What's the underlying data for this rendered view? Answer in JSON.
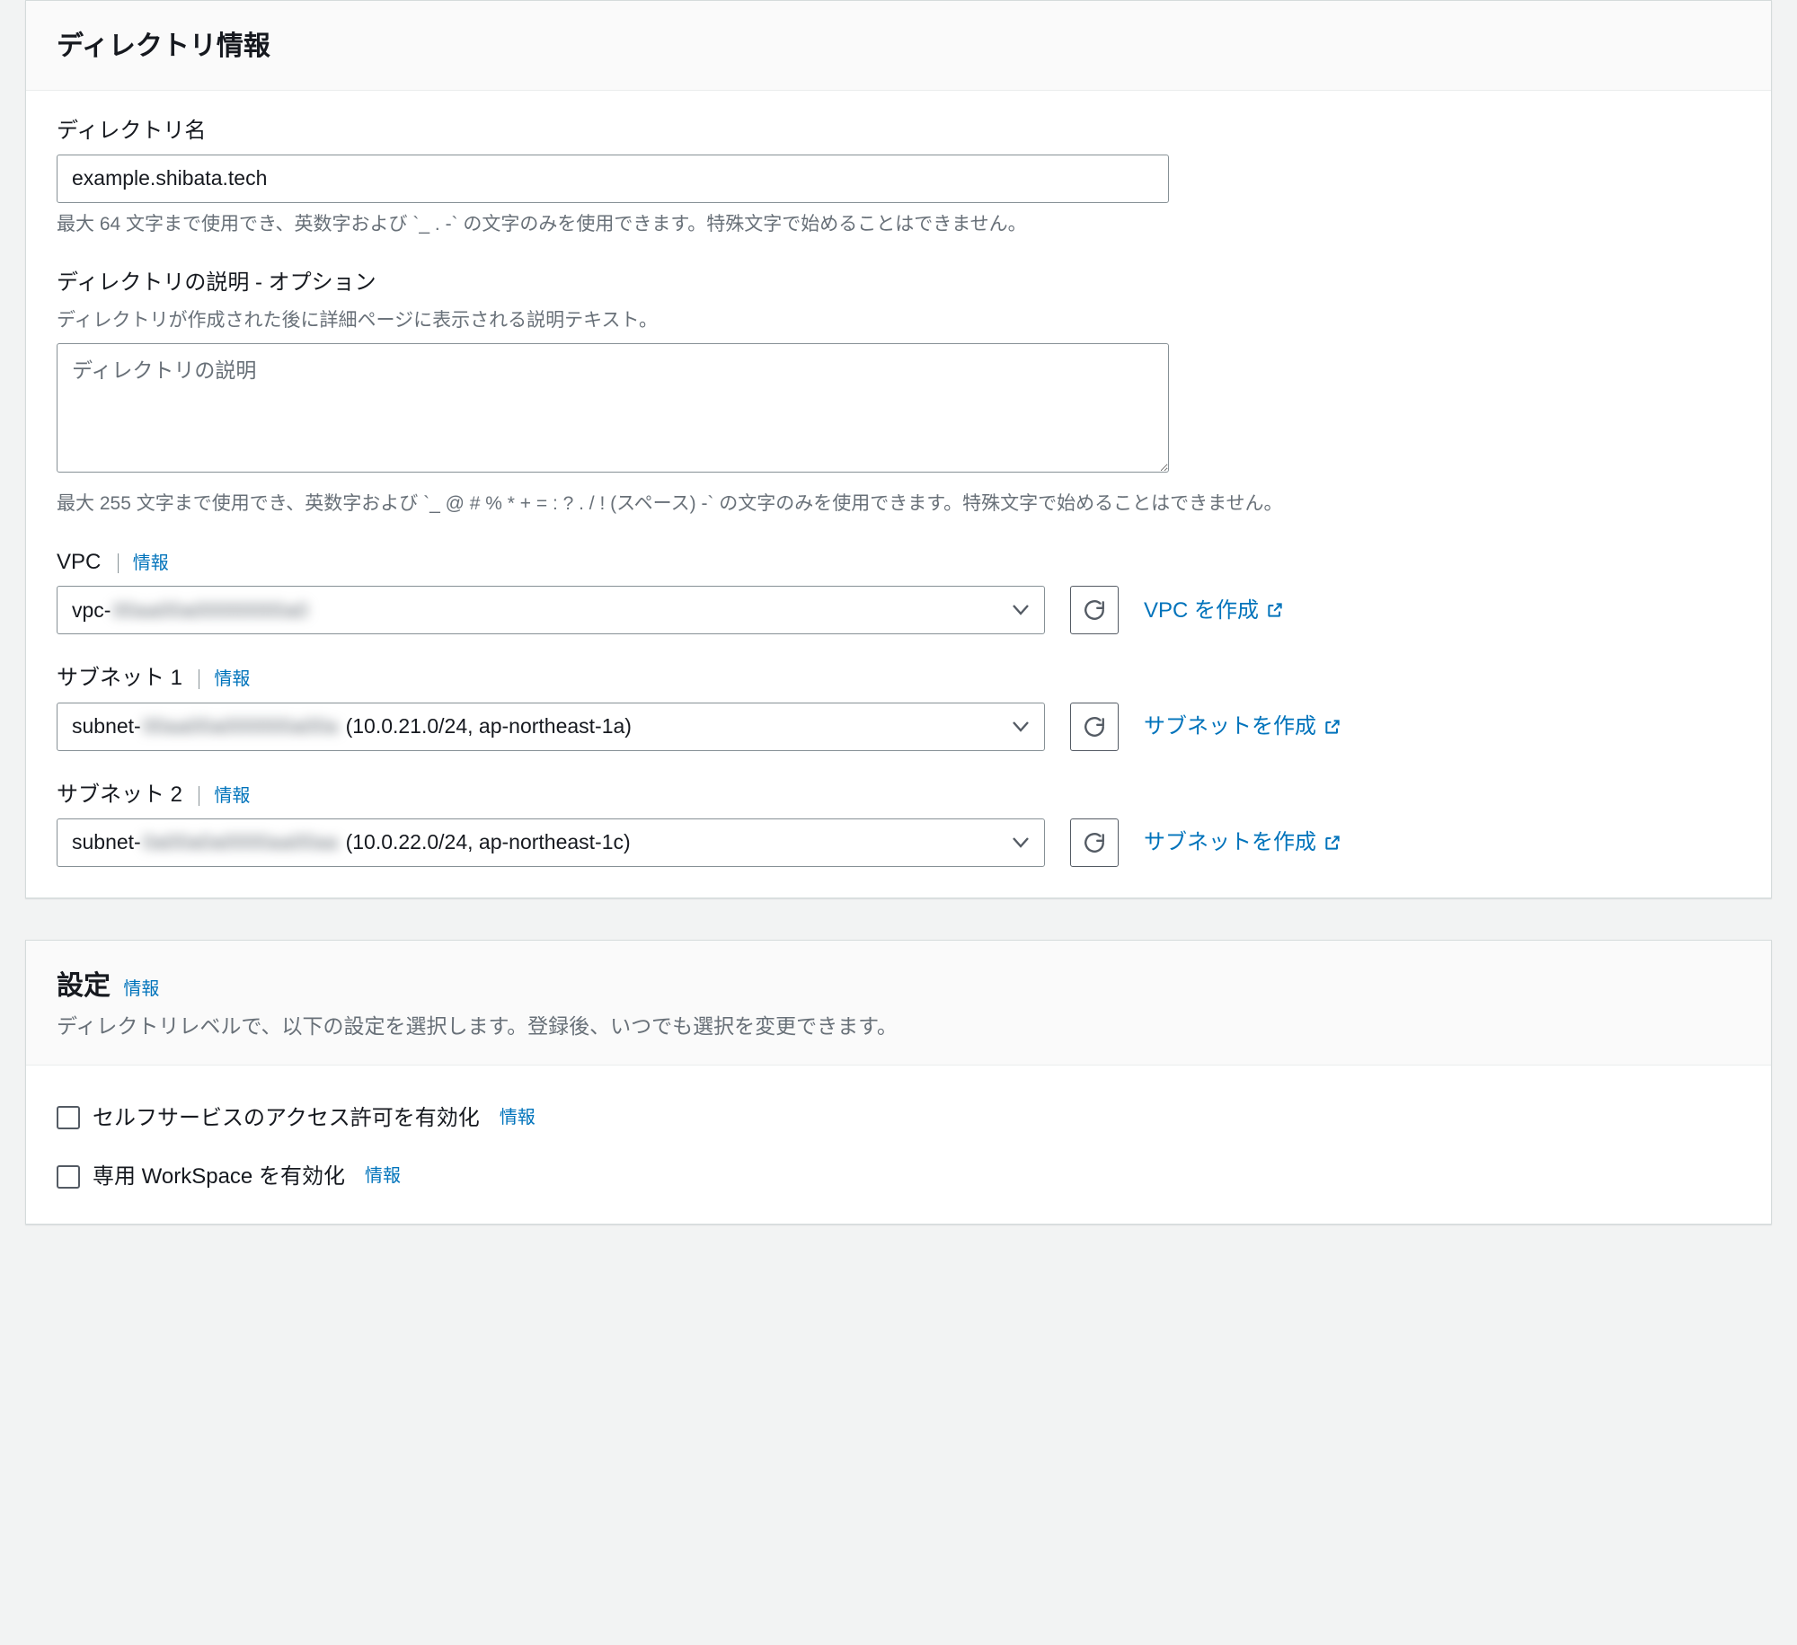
{
  "info_label": "情報",
  "panel1": {
    "title": "ディレクトリ情報",
    "name": {
      "label": "ディレクトリ名",
      "value": "example.shibata.tech",
      "hint": "最大 64 文字まで使用でき、英数字および `_ . -` の文字のみを使用できます。特殊文字で始めることはできません。"
    },
    "description": {
      "label": "ディレクトリの説明 - オプション",
      "sub": "ディレクトリが作成された後に詳細ページに表示される説明テキスト。",
      "placeholder": "ディレクトリの説明",
      "hint": "最大 255 文字まで使用でき、英数字および `_ @ # % * + = : ? . / ! (スペース) -` の文字のみを使用できます。特殊文字で始めることはできません。"
    },
    "vpc": {
      "label": "VPC",
      "value_prefix": "vpc-",
      "value_blur": "00aa00a00000000a0",
      "value_suffix": "",
      "create": "VPC を作成"
    },
    "subnet1": {
      "label": "サブネット 1",
      "value_prefix": "subnet-",
      "value_blur": "00aa00a000000a00a",
      "value_suffix": " (10.0.21.0/24, ap-northeast-1a)",
      "create": "サブネットを作成"
    },
    "subnet2": {
      "label": "サブネット 2",
      "value_prefix": "subnet-",
      "value_blur": "0a00a0a0000aa00aa",
      "value_suffix": " (10.0.22.0/24, ap-northeast-1c)",
      "create": "サブネットを作成"
    }
  },
  "panel2": {
    "title": "設定",
    "desc": "ディレクトリレベルで、以下の設定を選択します。登録後、いつでも選択を変更できます。",
    "checkbox1": "セルフサービスのアクセス許可を有効化",
    "checkbox2": "専用 WorkSpace を有効化"
  }
}
